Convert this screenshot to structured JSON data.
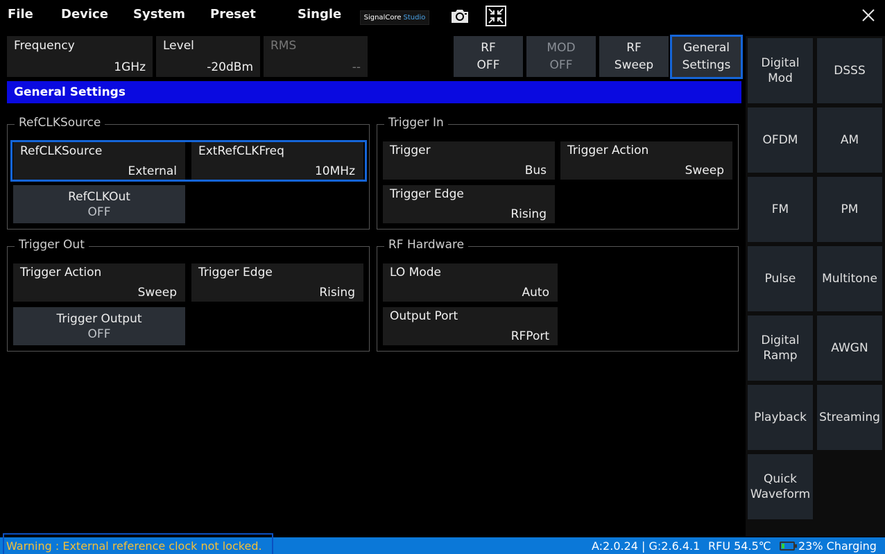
{
  "menu": {
    "file": "File",
    "device": "Device",
    "system": "System",
    "preset": "Preset",
    "single": "Single"
  },
  "brand": {
    "name": "SignalCore",
    "suffix": "Studio"
  },
  "icons": {
    "camera": "camera-icon",
    "collapse": "collapse-arrows-icon",
    "close": "close-icon"
  },
  "params": {
    "frequency": {
      "label": "Frequency",
      "value": "1GHz"
    },
    "level": {
      "label": "Level",
      "value": "-20dBm"
    },
    "rms": {
      "label": "RMS",
      "value": "--"
    }
  },
  "modes": {
    "rf": {
      "line1": "RF",
      "line2": "OFF"
    },
    "mod": {
      "line1": "MOD",
      "line2": "OFF"
    },
    "sweep": {
      "line1": "RF",
      "line2": "Sweep"
    },
    "general": {
      "line1": "General",
      "line2": "Settings"
    }
  },
  "section_title": "General Settings",
  "refclk": {
    "title": "RefCLKSource",
    "source": {
      "label": "RefCLKSource",
      "value": "External"
    },
    "ext_freq": {
      "label": "ExtRefCLKFreq",
      "value": "10MHz"
    },
    "out": {
      "label": "RefCLKOut",
      "value": "OFF"
    }
  },
  "trigger_in": {
    "title": "Trigger In",
    "trigger": {
      "label": "Trigger",
      "value": "Bus"
    },
    "action": {
      "label": "Trigger Action",
      "value": "Sweep"
    },
    "edge": {
      "label": "Trigger Edge",
      "value": "Rising"
    }
  },
  "trigger_out": {
    "title": "Trigger Out",
    "action": {
      "label": "Trigger Action",
      "value": "Sweep"
    },
    "edge": {
      "label": "Trigger Edge",
      "value": "Rising"
    },
    "output": {
      "label": "Trigger Output",
      "value": "OFF"
    }
  },
  "rf_hardware": {
    "title": "RF Hardware",
    "lo_mode": {
      "label": "LO Mode",
      "value": "Auto"
    },
    "output_port": {
      "label": "Output Port",
      "value": "RFPort"
    }
  },
  "sidebar": {
    "digital_mod": {
      "line1": "Digital",
      "line2": "Mod"
    },
    "dsss": "DSSS",
    "ofdm": "OFDM",
    "am": "AM",
    "fm": "FM",
    "pm": "PM",
    "pulse": "Pulse",
    "multitone": "Multitone",
    "digital_ramp": {
      "line1": "Digital",
      "line2": "Ramp"
    },
    "awgn": "AWGN",
    "playback": "Playback",
    "streaming": "Streaming",
    "quick_waveform": {
      "line1": "Quick",
      "line2": "Waveform"
    }
  },
  "status": {
    "warning": "Warning : External reference clock not locked.",
    "version": "A:2.0.24 | G:2.6.4.1",
    "temperature": "RFU 54.5℃",
    "battery": "23% Charging",
    "battery_level": 0.23
  },
  "colors": {
    "accent": "#1565d8",
    "title_bar": "#0a0ae0",
    "status_bar": "#0b78d8",
    "warning": "#f5c038"
  }
}
